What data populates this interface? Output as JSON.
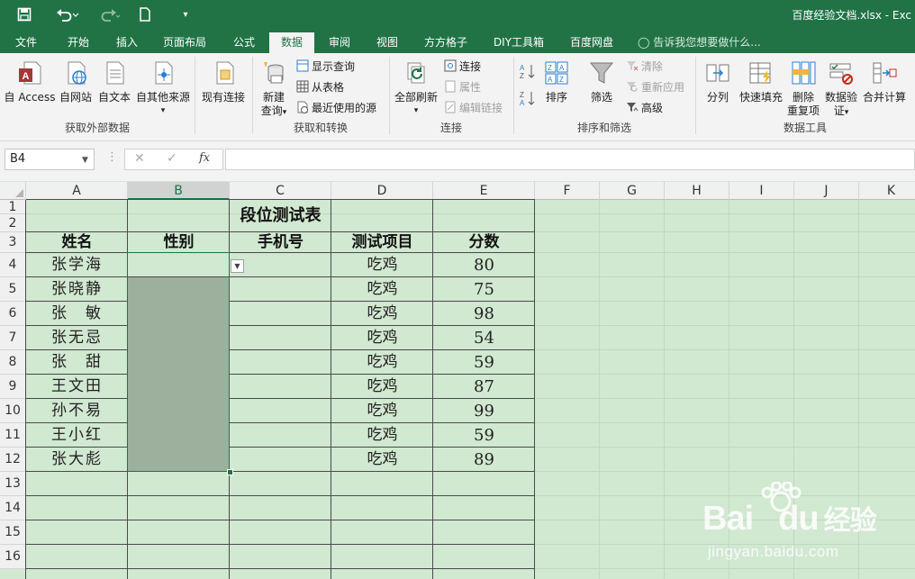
{
  "window": {
    "title": "百度经验文档.xlsx - Exc",
    "quick_access": [
      "save-icon",
      "undo-icon",
      "redo-icon",
      "new-file-icon",
      "customize-icon"
    ]
  },
  "tabs": [
    {
      "label": "文件",
      "active": false
    },
    {
      "label": "开始",
      "active": false
    },
    {
      "label": "插入",
      "active": false
    },
    {
      "label": "页面布局",
      "active": false
    },
    {
      "label": "公式",
      "active": false
    },
    {
      "label": "数据",
      "active": true
    },
    {
      "label": "审阅",
      "active": false
    },
    {
      "label": "视图",
      "active": false
    },
    {
      "label": "方方格子",
      "active": false
    },
    {
      "label": "DIY工具箱",
      "active": false
    },
    {
      "label": "百度网盘",
      "active": false
    }
  ],
  "tell_me": "告诉我您想要做什么...",
  "ribbon": {
    "groups": {
      "external": "获取外部数据",
      "transform": "获取和转换",
      "connections": "连接",
      "sortfilter": "排序和筛选",
      "tools": "数据工具"
    },
    "external": {
      "access": "自 Access",
      "web": "自网站",
      "text": "自文本",
      "other": "自其他来源",
      "existing": "现有连接"
    },
    "transform": {
      "new_query_1": "新建",
      "new_query_2": "查询",
      "show_query": "显示查询",
      "from_table": "从表格",
      "recent_sources": "最近使用的源"
    },
    "connections": {
      "refresh_all": "全部刷新",
      "connections": "连接",
      "properties": "属性",
      "edit_links": "编辑链接"
    },
    "sortfilter": {
      "sort": "排序",
      "filter": "筛选",
      "clear": "清除",
      "reapply": "重新应用",
      "advanced": "高级"
    },
    "tools": {
      "split": "分列",
      "flash_fill": "快速填充",
      "remove_dup_1": "删除",
      "remove_dup_2": "重复项",
      "validation_1": "数据验",
      "validation_2": "证",
      "consolidate": "合并计算"
    }
  },
  "formula_bar": {
    "name_box": "B4",
    "cancel": "✕",
    "enter": "✓",
    "fx": "fx",
    "value": ""
  },
  "sheet": {
    "columns": [
      "A",
      "B",
      "C",
      "D",
      "E",
      "F",
      "G",
      "H",
      "I",
      "J",
      "K"
    ],
    "rows": [
      "1",
      "2",
      "3",
      "4",
      "5",
      "6",
      "7",
      "8",
      "9",
      "10",
      "11",
      "12",
      "13",
      "14",
      "15",
      "16"
    ],
    "selected_column": "B",
    "active_cell": "B4",
    "table_title": "段位测试表",
    "headers": [
      "姓名",
      "性别",
      "手机号",
      "测试项目",
      "分数"
    ],
    "records": [
      {
        "name": "张学海",
        "gender": "",
        "phone": "",
        "item": "吃鸡",
        "score": "80"
      },
      {
        "name": "张晓静",
        "gender": "",
        "phone": "",
        "item": "吃鸡",
        "score": "75"
      },
      {
        "name": "张　敏",
        "gender": "",
        "phone": "",
        "item": "吃鸡",
        "score": "98"
      },
      {
        "name": "张无忌",
        "gender": "",
        "phone": "",
        "item": "吃鸡",
        "score": "54"
      },
      {
        "name": "张　甜",
        "gender": "",
        "phone": "",
        "item": "吃鸡",
        "score": "59"
      },
      {
        "name": "王文田",
        "gender": "",
        "phone": "",
        "item": "吃鸡",
        "score": "87"
      },
      {
        "name": "孙不易",
        "gender": "",
        "phone": "",
        "item": "吃鸡",
        "score": "99"
      },
      {
        "name": "王小红",
        "gender": "",
        "phone": "",
        "item": "吃鸡",
        "score": "59"
      },
      {
        "name": "张大彪",
        "gender": "",
        "phone": "",
        "item": "吃鸡",
        "score": "89"
      }
    ],
    "dropdown_icon": "dropdown-arrow-icon"
  },
  "watermark": {
    "brand": "Bai",
    "brand2": "du",
    "cn": "经验",
    "url": "jingyan.baidu.com"
  },
  "colors": {
    "excel_green": "#217346",
    "sheet_background": "#d1e8d1",
    "selection_fill": "#9db09d"
  }
}
